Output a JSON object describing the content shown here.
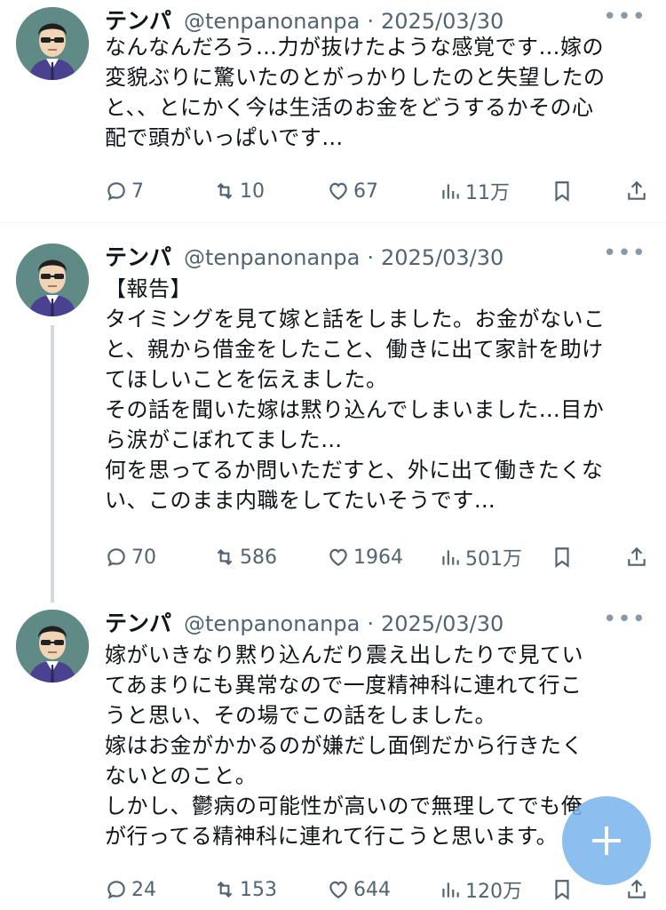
{
  "tweets": [
    {
      "name": "テンパ",
      "handle": "@tenpanonanpa",
      "date": "2025/03/30",
      "more": "•••",
      "lines": [
        "なんなんだろう…力が抜けたような感覚です…嫁の",
        "変貌ぶりに驚いたのとがっかりしたのと失望したの",
        "と、、とにかく今は生活のお金をどうするかその心",
        "配で頭がいっぱいです…"
      ],
      "replies": "7",
      "retweets": "10",
      "likes": "67",
      "views": "11万"
    },
    {
      "name": "テンパ",
      "handle": "@tenpanonanpa",
      "date": "2025/03/30",
      "more": "•••",
      "lines": [
        "【報告】",
        "タイミングを見て嫁と話をしました。お金がないこ",
        "と、親から借金をしたこと、働きに出て家計を助け",
        "てほしいことを伝えました。",
        "その話を聞いた嫁は黙り込んでしまいました…目か",
        "ら涙がこぼれてました…",
        "何を思ってるか問いただすと、外に出て働きたくな",
        "い、このまま内職をしてたいそうです…"
      ],
      "replies": "70",
      "retweets": "586",
      "likes": "1964",
      "views": "501万"
    },
    {
      "name": "テンパ",
      "handle": "@tenpanonanpa",
      "date": "2025/03/30",
      "more": "•••",
      "lines": [
        "嫁がいきなり黙り込んだり震え出したりで見てい",
        "てあまりにも異常なので一度精神科に連れて行こ",
        "うと思い、その場でこの話をしました。",
        "嫁はお金がかかるのが嫌だし面倒だから行きたく",
        "ないとのこと。",
        "しかし、鬱病の可能性が高いので無理してでも俺",
        "が行ってる精神科に連れて行こうと思います。"
      ],
      "replies": "24",
      "retweets": "153",
      "likes": "644",
      "views": "120万"
    }
  ],
  "icons": {
    "reply": "reply-icon",
    "retweet": "retweet-icon",
    "like": "heart-icon",
    "views": "views-icon",
    "bookmark": "bookmark-icon",
    "share": "share-icon",
    "compose": "plus-icon"
  },
  "colors": {
    "text": "#0f1419",
    "secondary": "#536471",
    "divider": "#eff3f4",
    "thread_line": "#cfd9de",
    "fab": "#78b4eb"
  }
}
